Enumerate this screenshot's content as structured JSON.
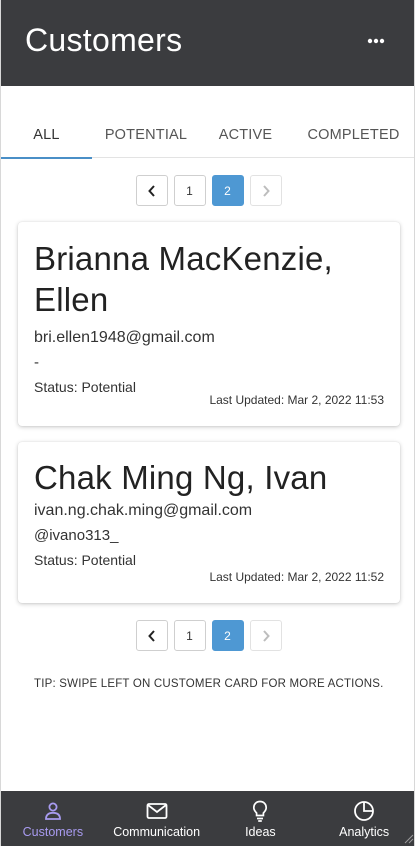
{
  "header": {
    "title": "Customers",
    "more_icon": "more-horizontal-icon"
  },
  "tabs": [
    {
      "label": "ALL",
      "active": true
    },
    {
      "label": "POTENTIAL",
      "active": false
    },
    {
      "label": "ACTIVE",
      "active": false
    },
    {
      "label": "COMPLETED",
      "active": false
    }
  ],
  "pagination": {
    "prev_icon": "chevron-left-icon",
    "next_icon": "chevron-right-icon",
    "pages": [
      "1",
      "2"
    ],
    "current_page": "2"
  },
  "customers": [
    {
      "name": "Brianna MacKenzie, Ellen",
      "email": "bri.ellen1948@gmail.com",
      "social": "-",
      "status": "Status: Potential",
      "last_updated": "Last Updated: Mar 2, 2022 11:53"
    },
    {
      "name": "Chak Ming Ng, Ivan",
      "email": "ivan.ng.chak.ming@gmail.com",
      "social": "@ivano313_",
      "status": "Status: Potential",
      "last_updated": "Last Updated: Mar 2, 2022 11:52"
    }
  ],
  "tip": "TIP: SWIPE LEFT ON CUSTOMER CARD FOR MORE ACTIONS.",
  "bottom_nav": [
    {
      "label": "Customers",
      "icon": "person-icon",
      "active": true
    },
    {
      "label": "Communication",
      "icon": "mail-icon",
      "active": false
    },
    {
      "label": "Ideas",
      "icon": "lightbulb-icon",
      "active": false
    },
    {
      "label": "Analytics",
      "icon": "pie-chart-icon",
      "active": false
    }
  ],
  "colors": {
    "header_bg": "#3b3c3f",
    "accent": "#4e98d3",
    "nav_active": "#a89bf0"
  }
}
